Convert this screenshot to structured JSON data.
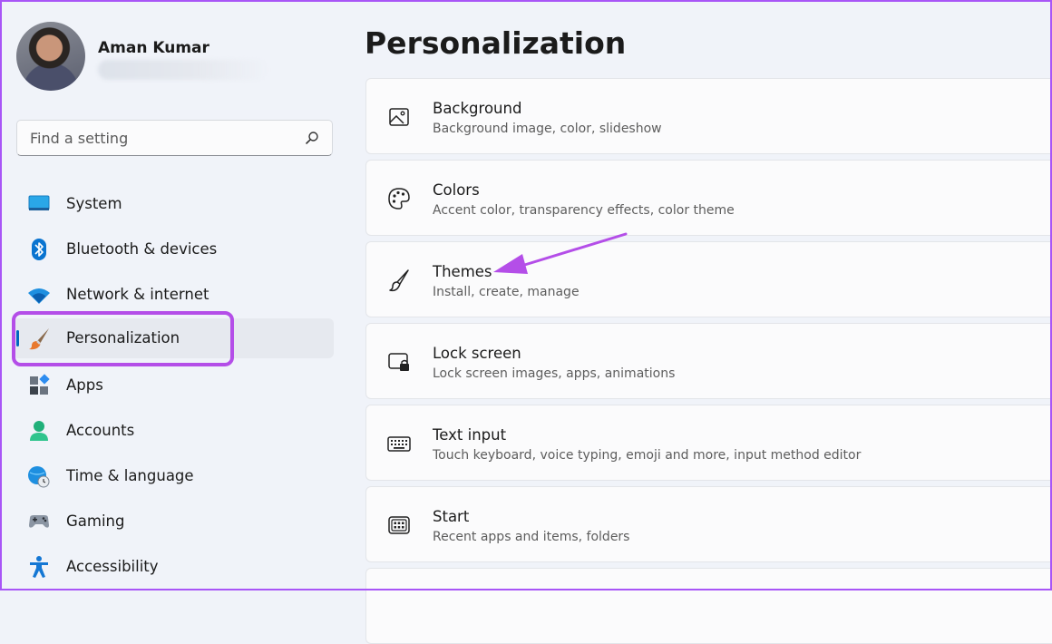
{
  "user": {
    "name": "Aman Kumar"
  },
  "search": {
    "placeholder": "Find a setting"
  },
  "sidebar": {
    "items": [
      {
        "label": "System"
      },
      {
        "label": "Bluetooth & devices"
      },
      {
        "label": "Network & internet"
      },
      {
        "label": "Personalization"
      },
      {
        "label": "Apps"
      },
      {
        "label": "Accounts"
      },
      {
        "label": "Time & language"
      },
      {
        "label": "Gaming"
      },
      {
        "label": "Accessibility"
      }
    ],
    "selected": "Personalization"
  },
  "main": {
    "title": "Personalization",
    "cards": [
      {
        "title": "Background",
        "subtitle": "Background image, color, slideshow",
        "icon": "image-icon"
      },
      {
        "title": "Colors",
        "subtitle": "Accent color, transparency effects, color theme",
        "icon": "palette-icon"
      },
      {
        "title": "Themes",
        "subtitle": "Install, create, manage",
        "icon": "brush-icon"
      },
      {
        "title": "Lock screen",
        "subtitle": "Lock screen images, apps, animations",
        "icon": "lock-screen-icon"
      },
      {
        "title": "Text input",
        "subtitle": "Touch keyboard, voice typing, emoji and more, input method editor",
        "icon": "keyboard-icon"
      },
      {
        "title": "Start",
        "subtitle": "Recent apps and items, folders",
        "icon": "start-icon"
      }
    ]
  },
  "colors": {
    "accent": "#0067c0",
    "annotation": "#b44ee8"
  }
}
